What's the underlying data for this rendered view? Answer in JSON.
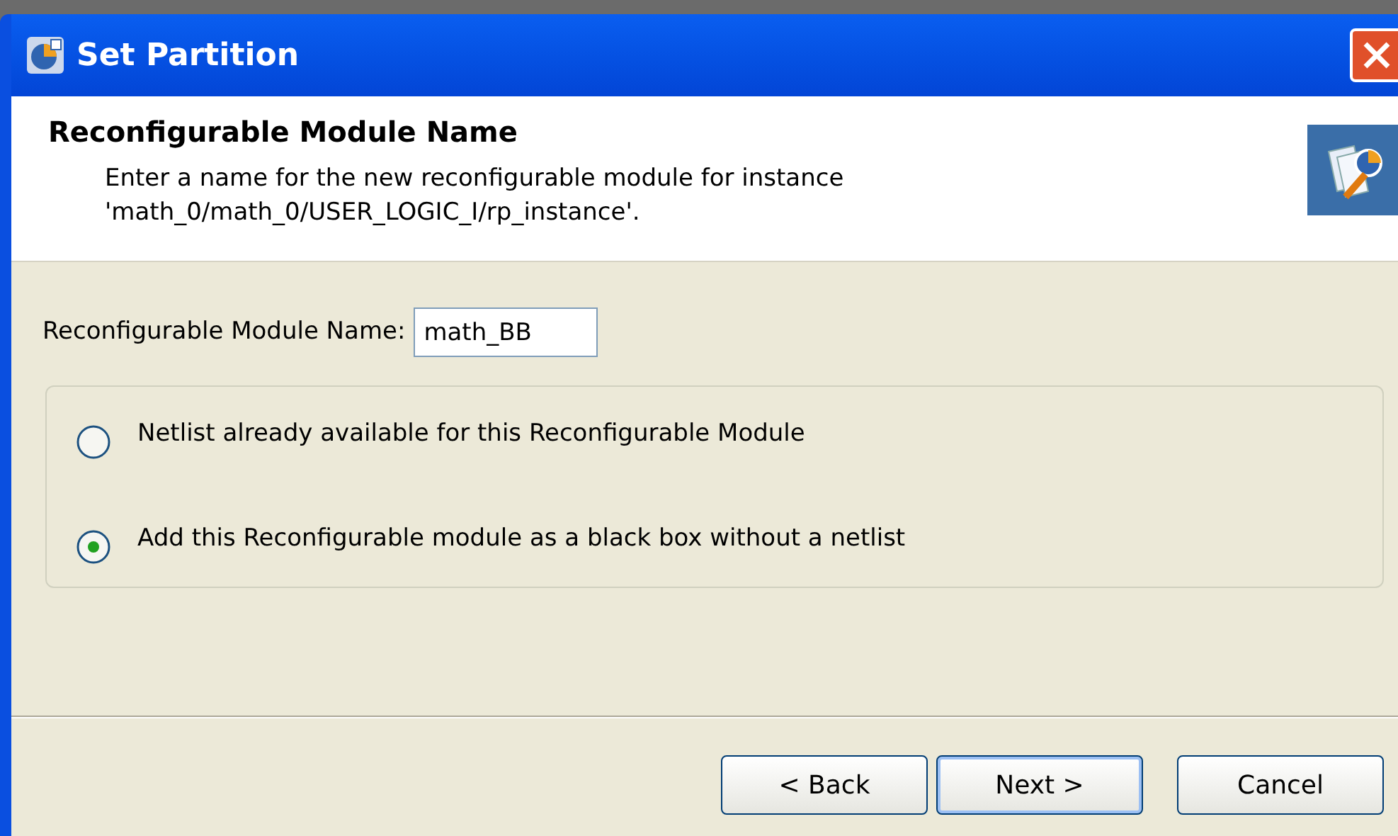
{
  "window": {
    "title": "Set Partition"
  },
  "header": {
    "title": "Reconfigurable Module Name",
    "description": "Enter a name for the new reconfigurable module for instance\n'math_0/math_0/USER_LOGIC_I/rp_instance'."
  },
  "name_field": {
    "label": "Reconfigurable Module Name:",
    "value": "math_BB"
  },
  "options": [
    {
      "label": "Netlist already available for this Reconfigurable Module",
      "selected": false
    },
    {
      "label": "Add this Reconfigurable module as a black box without a netlist",
      "selected": true
    }
  ],
  "buttons": [
    {
      "label": "< Back",
      "default": false
    },
    {
      "label": "Next >",
      "default": true
    },
    {
      "label": "Cancel",
      "default": false
    }
  ]
}
